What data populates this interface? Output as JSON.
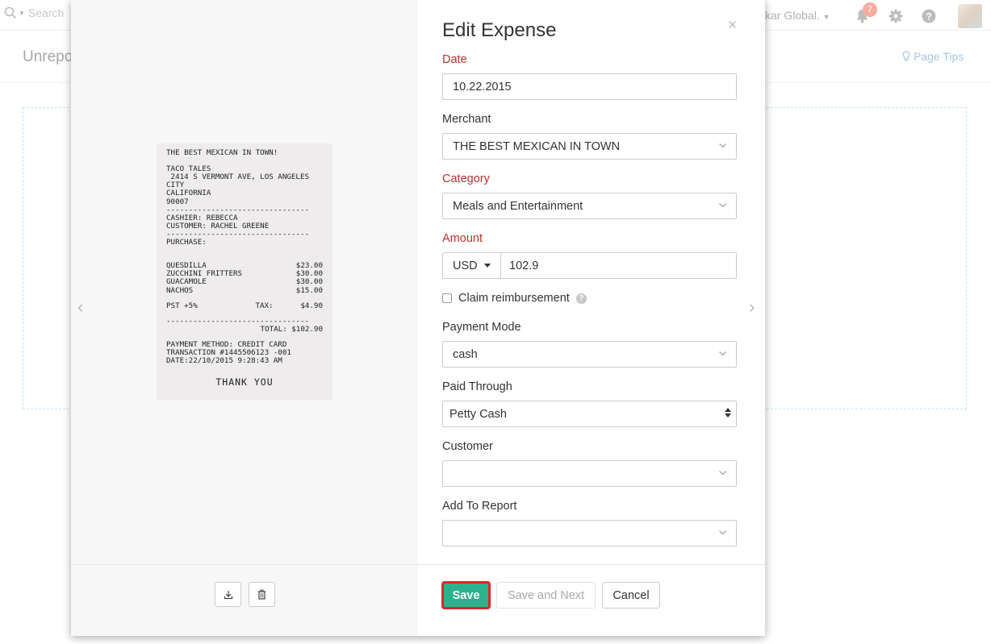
{
  "background": {
    "search": {
      "placeholder": "Search"
    },
    "org_name": "kar Global.",
    "notification_count": "7",
    "page_heading": "Unrepo",
    "page_tips": "Page Tips"
  },
  "receipt": {
    "lines": [
      "THE BEST MEXICAN IN TOWN!",
      "",
      "TACO TALES",
      " 2414 S VERMONT AVE, LOS ANGELES",
      "CITY",
      "CALIFORNIA",
      "90007",
      "--------------------------------",
      "CASHIER: REBECCA",
      "CUSTOMER: RACHEL GREENE",
      "--------------------------------",
      "PURCHASE:",
      ""
    ],
    "items": [
      {
        "name": "QUESDILLA",
        "price": "$23.00"
      },
      {
        "name": "ZUCCHINI FRITTERS",
        "price": "$30.00"
      },
      {
        "name": "GUACAMOLE",
        "price": "$30.00"
      },
      {
        "name": "NACHOS",
        "price": "$15.00"
      }
    ],
    "tax_label": "PST +5%",
    "tax_mid": "TAX:",
    "tax_value": "$4.90",
    "divider": "--------------------------------",
    "total": "TOTAL: $102.90",
    "payment_lines": [
      "PAYMENT METHOD: CREDIT CARD",
      "TRANSACTION #1445506123 -001",
      "DATE:22/10/2015 9:28:43 AM"
    ],
    "thanks": "THANK YOU"
  },
  "form": {
    "title": "Edit Expense",
    "close": "×",
    "date": {
      "label": "Date",
      "value": "10.22.2015"
    },
    "merchant": {
      "label": "Merchant",
      "value": "THE BEST MEXICAN IN TOWN"
    },
    "category": {
      "label": "Category",
      "value": "Meals and Entertainment"
    },
    "amount": {
      "label": "Amount",
      "currency": "USD",
      "value": "102.9"
    },
    "claim": {
      "label": "Claim reimbursement",
      "checked": false
    },
    "payment_mode": {
      "label": "Payment Mode",
      "value": "cash"
    },
    "paid_through": {
      "label": "Paid Through",
      "value": "Petty Cash"
    },
    "customer": {
      "label": "Customer",
      "value": ""
    },
    "report": {
      "label": "Add To Report",
      "value": ""
    }
  },
  "footer": {
    "save": "Save",
    "save_next": "Save and Next",
    "cancel": "Cancel"
  },
  "colors": {
    "required_label": "#b5322d",
    "save_button": "#2bb38e",
    "save_highlight": "#e0242b",
    "badge": "#f0816d",
    "link": "#7aa8d8"
  }
}
